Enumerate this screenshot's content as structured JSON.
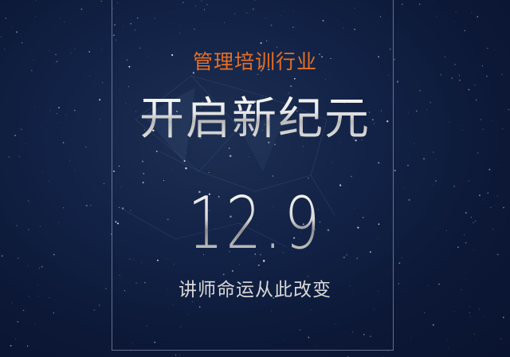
{
  "poster": {
    "subtitle": "管理培训行业",
    "headline": "开启新纪元",
    "date": "12.9",
    "tagline": "讲师命运从此改变"
  },
  "colors": {
    "background": "#0c1836",
    "accent": "#e86f24",
    "frame": "#aab8d2",
    "text": "#e6e6e6"
  }
}
